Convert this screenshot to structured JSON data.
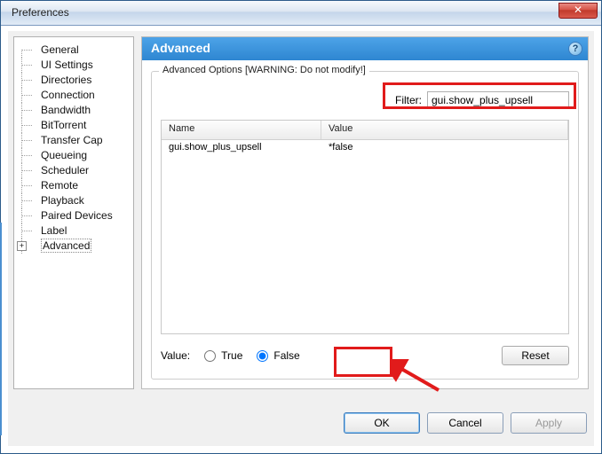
{
  "window": {
    "title": "Preferences",
    "close_glyph": "✕"
  },
  "sidebar": {
    "items": [
      {
        "label": "General"
      },
      {
        "label": "UI Settings"
      },
      {
        "label": "Directories"
      },
      {
        "label": "Connection"
      },
      {
        "label": "Bandwidth"
      },
      {
        "label": "BitTorrent"
      },
      {
        "label": "Transfer Cap"
      },
      {
        "label": "Queueing"
      },
      {
        "label": "Scheduler"
      },
      {
        "label": "Remote"
      },
      {
        "label": "Playback"
      },
      {
        "label": "Paired Devices"
      },
      {
        "label": "Label"
      },
      {
        "label": "Advanced",
        "expander": "+",
        "selected": true
      }
    ]
  },
  "page": {
    "title": "Advanced",
    "help_glyph": "?",
    "groupbox_legend": "Advanced Options [WARNING: Do not modify!]",
    "filter_label": "Filter:",
    "filter_value": "gui.show_plus_upsell",
    "columns": {
      "name": "Name",
      "value": "Value"
    },
    "rows": [
      {
        "name": "gui.show_plus_upsell",
        "value": "*false"
      }
    ],
    "value_label": "Value:",
    "radio_true": "True",
    "radio_false": "False",
    "radio_selected": "false",
    "reset_label": "Reset"
  },
  "buttons": {
    "ok": "OK",
    "cancel": "Cancel",
    "apply": "Apply"
  }
}
